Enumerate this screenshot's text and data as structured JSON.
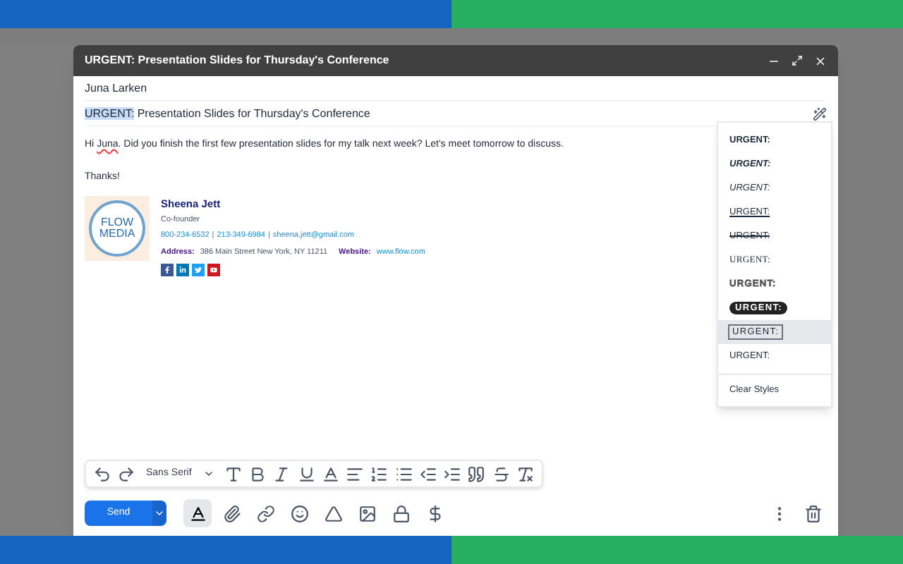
{
  "window": {
    "title": "URGENT: Presentation Slides for Thursday's Conference"
  },
  "recipient": "Juna Larken",
  "subject": {
    "selected_text": "URGENT:",
    "rest": " Presentation Slides for Thursday's Conference"
  },
  "body": {
    "before": "Hi ",
    "flagged": "Juna",
    "after": ". Did you finish the first few presentation slides for my talk next week? Let's meet tomorrow to discuss.",
    "closing": "Thanks!"
  },
  "signature": {
    "logo_top": "FLOW",
    "logo_bottom": "MEDIA",
    "name": "Sheena Jett",
    "role": "Co-founder",
    "separator": "|",
    "phone1": "800-234-6532",
    "phone2": "213-349-6984",
    "email": "sheena.jett@gmail.com",
    "address_label": "Address:",
    "address": "386 Main Street New York, NY 11211",
    "website_label": "Website:",
    "website": "www.flow.com"
  },
  "style_menu": {
    "items": [
      {
        "label": "URGENT:",
        "kind": "bold",
        "selected": false
      },
      {
        "label": "URGENT:",
        "kind": "bold-italic",
        "selected": false
      },
      {
        "label": "URGENT:",
        "kind": "italic",
        "selected": false
      },
      {
        "label": "URGENT:",
        "kind": "underline",
        "selected": false
      },
      {
        "label": "URGENT:",
        "kind": "strike",
        "selected": false
      },
      {
        "label": "URGENT:",
        "kind": "serif",
        "selected": false
      },
      {
        "label": "URGENT:",
        "kind": "outline",
        "selected": false
      },
      {
        "label": "URGENT:",
        "kind": "circled",
        "selected": false
      },
      {
        "label": "URGENT:",
        "kind": "boxed",
        "selected": true
      },
      {
        "label": "URGENT:",
        "kind": "plain",
        "selected": false
      }
    ],
    "clear": "Clear Styles"
  },
  "format_bar": {
    "font": "Sans Serif"
  },
  "send": "Send"
}
